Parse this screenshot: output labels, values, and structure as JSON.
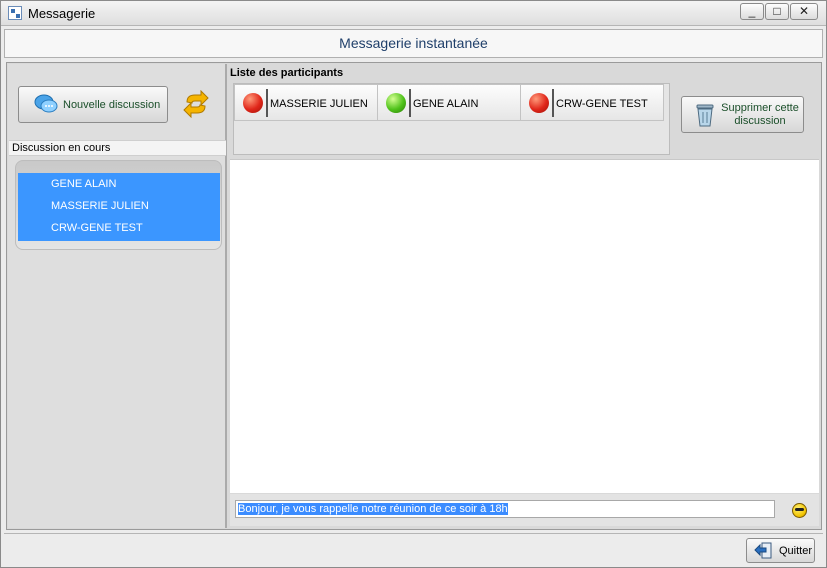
{
  "window": {
    "title": "Messagerie",
    "controls": [
      "_",
      "□",
      "✕"
    ]
  },
  "header": {
    "title": "Messagerie instantanée"
  },
  "left_panel": {
    "new_discussion_label": "Nouvelle discussion",
    "section_label": "Discussion en cours",
    "discussions": [
      {
        "name": "GENE ALAIN"
      },
      {
        "name": "MASSERIE JULIEN"
      },
      {
        "name": "CRW-GENE TEST"
      }
    ]
  },
  "participants": {
    "label": "Liste des participants",
    "items": [
      {
        "name": "MASSERIE JULIEN",
        "status_color": "red"
      },
      {
        "name": "GENE ALAIN",
        "status_color": "green"
      },
      {
        "name": "CRW-GENE TEST",
        "status_color": "red"
      }
    ],
    "delete_label_line1": "Supprimer cette",
    "delete_label_line2": "discussion"
  },
  "message": {
    "input_value": "Bonjour, je vous rappelle notre réunion de ce soir à 18h"
  },
  "footer": {
    "quit_label": "Quitter"
  }
}
